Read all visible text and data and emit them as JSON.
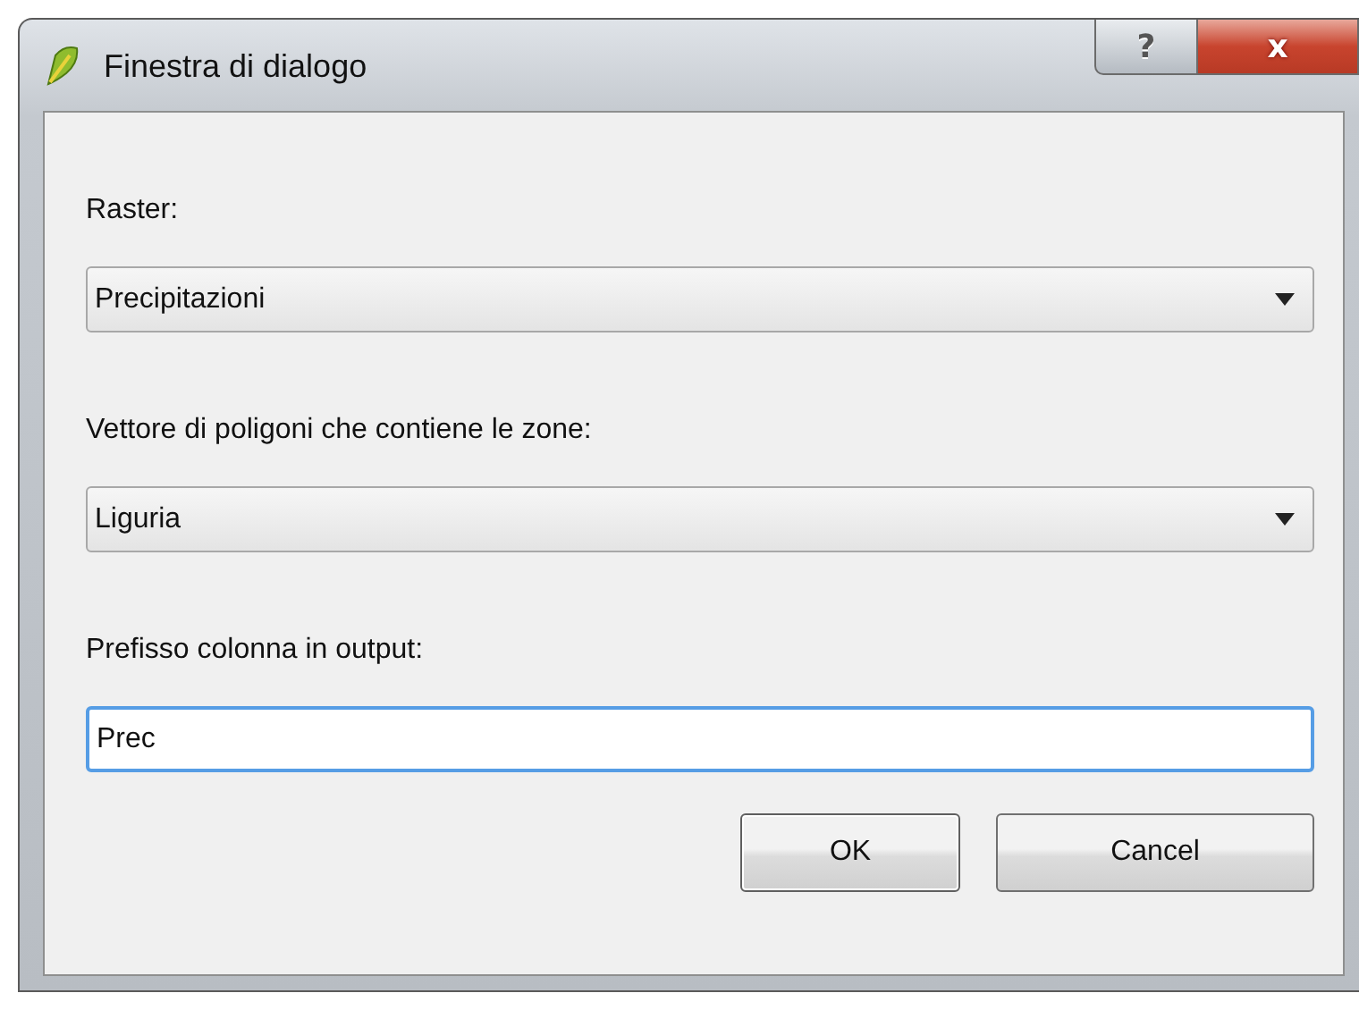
{
  "window": {
    "title": "Finestra di dialogo",
    "help_button": "?",
    "close_button": "x"
  },
  "fields": [
    {
      "kind": "dropdown",
      "label": "Raster:",
      "value": "Precipitazioni"
    },
    {
      "kind": "dropdown",
      "label": "Vettore di poligoni che contiene le zone:",
      "value": "Liguria"
    },
    {
      "kind": "text",
      "label": "Prefisso colonna in output:",
      "value": "Prec",
      "focused": true
    }
  ],
  "buttons": [
    {
      "label": "OK",
      "default": true
    },
    {
      "label": "Cancel",
      "default": false
    }
  ]
}
